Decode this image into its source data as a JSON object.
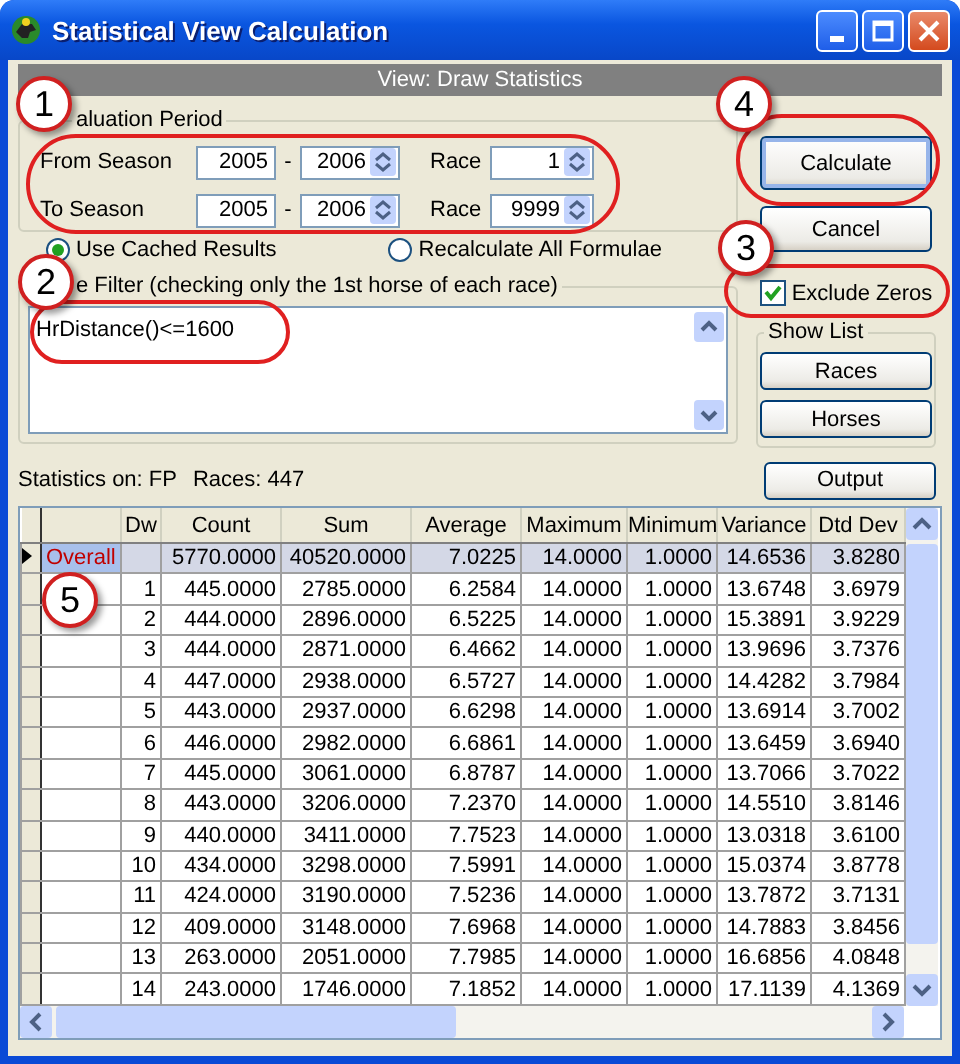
{
  "window": {
    "title": "Statistical View Calculation"
  },
  "view_header": "View: Draw Statistics",
  "evaluation_period": {
    "label": "aluation Period",
    "rows": [
      {
        "label": "From Season",
        "start": "2005",
        "separator": "-",
        "end": "2006",
        "race_label": "Race",
        "race": "1"
      },
      {
        "label": "To Season",
        "start": "2005",
        "separator": "-",
        "end": "2006",
        "race_label": "Race",
        "race": "9999"
      }
    ]
  },
  "calculation_mode": [
    {
      "label": "Use Cached Results",
      "selected": true
    },
    {
      "label": "Recalculate All Formulae",
      "selected": false
    }
  ],
  "filter": {
    "label": "e Filter (checking only the 1st horse of each race)",
    "value": "HrDistance()<=1600"
  },
  "calculate_button": "Calculate",
  "cancel_button": "Cancel",
  "exclude_zeros": {
    "label": "Exclude Zeros",
    "checked": true
  },
  "show_list": {
    "label": "Show List",
    "buttons": [
      "Races",
      "Horses"
    ]
  },
  "status": {
    "statistics_on": "Statistics on: FP",
    "races": "Races: 447"
  },
  "output_button": "Output",
  "table": {
    "columns": [
      "Dw",
      "Count",
      "Sum",
      "Average",
      "Maximum",
      "Minimum",
      "Variance",
      "Dtd Dev"
    ],
    "rows": [
      {
        "name": "Overall",
        "selected": true,
        "values": [
          "5770.0000",
          "40520.0000",
          "7.0225",
          "14.0000",
          "1.0000",
          "14.6536",
          "3.8280"
        ]
      },
      {
        "dw": "1",
        "selected": false,
        "values": [
          "445.0000",
          "2785.0000",
          "6.2584",
          "14.0000",
          "1.0000",
          "13.6748",
          "3.6979"
        ]
      },
      {
        "dw": "2",
        "selected": false,
        "values": [
          "444.0000",
          "2896.0000",
          "6.5225",
          "14.0000",
          "1.0000",
          "15.3891",
          "3.9229"
        ]
      },
      {
        "dw": "3",
        "selected": false,
        "values": [
          "444.0000",
          "2871.0000",
          "6.4662",
          "14.0000",
          "1.0000",
          "13.9696",
          "3.7376"
        ]
      },
      {
        "dw": "4",
        "selected": false,
        "values": [
          "447.0000",
          "2938.0000",
          "6.5727",
          "14.0000",
          "1.0000",
          "14.4282",
          "3.7984"
        ]
      },
      {
        "dw": "5",
        "selected": false,
        "values": [
          "443.0000",
          "2937.0000",
          "6.6298",
          "14.0000",
          "1.0000",
          "13.6914",
          "3.7002"
        ]
      },
      {
        "dw": "6",
        "selected": false,
        "values": [
          "446.0000",
          "2982.0000",
          "6.6861",
          "14.0000",
          "1.0000",
          "13.6459",
          "3.6940"
        ]
      },
      {
        "dw": "7",
        "selected": false,
        "values": [
          "445.0000",
          "3061.0000",
          "6.8787",
          "14.0000",
          "1.0000",
          "13.7066",
          "3.7022"
        ]
      },
      {
        "dw": "8",
        "selected": false,
        "values": [
          "443.0000",
          "3206.0000",
          "7.2370",
          "14.0000",
          "1.0000",
          "14.5510",
          "3.8146"
        ]
      },
      {
        "dw": "9",
        "selected": false,
        "values": [
          "440.0000",
          "3411.0000",
          "7.7523",
          "14.0000",
          "1.0000",
          "13.0318",
          "3.6100"
        ]
      },
      {
        "dw": "10",
        "selected": false,
        "values": [
          "434.0000",
          "3298.0000",
          "7.5991",
          "14.0000",
          "1.0000",
          "15.0374",
          "3.8778"
        ]
      },
      {
        "dw": "11",
        "selected": false,
        "values": [
          "424.0000",
          "3190.0000",
          "7.5236",
          "14.0000",
          "1.0000",
          "13.7872",
          "3.7131"
        ]
      },
      {
        "dw": "12",
        "selected": false,
        "values": [
          "409.0000",
          "3148.0000",
          "7.6968",
          "14.0000",
          "1.0000",
          "14.7883",
          "3.8456"
        ]
      },
      {
        "dw": "13",
        "selected": false,
        "values": [
          "263.0000",
          "2051.0000",
          "7.7985",
          "14.0000",
          "1.0000",
          "16.6856",
          "4.0848"
        ]
      },
      {
        "dw": "14",
        "selected": false,
        "values": [
          "243.0000",
          "1746.0000",
          "7.1852",
          "14.0000",
          "1.0000",
          "17.1139",
          "4.1369"
        ]
      }
    ]
  },
  "callouts": [
    "1",
    "2",
    "3",
    "4",
    "5"
  ]
}
